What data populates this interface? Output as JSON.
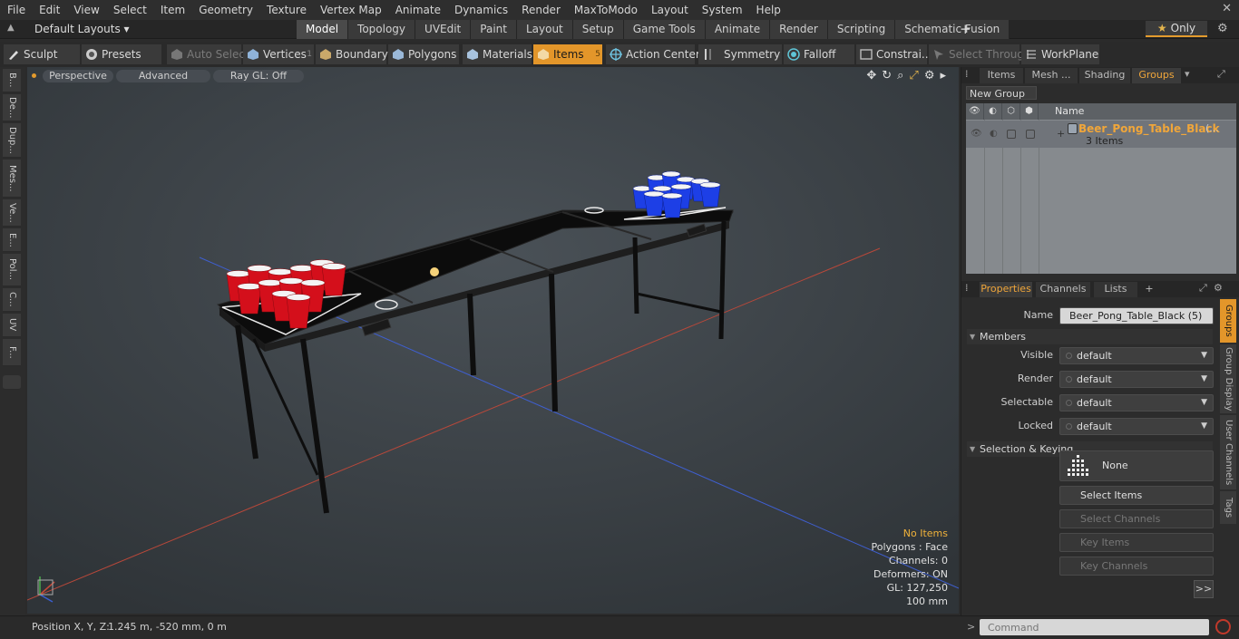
{
  "menu": [
    "File",
    "Edit",
    "View",
    "Select",
    "Item",
    "Geometry",
    "Texture",
    "Vertex Map",
    "Animate",
    "Dynamics",
    "Render",
    "MaxToModo",
    "Layout",
    "System",
    "Help"
  ],
  "layout": {
    "selector": "Default Layouts ▾",
    "tabs": [
      "Model",
      "Topology",
      "UVEdit",
      "Paint",
      "Layout",
      "Setup",
      "Game Tools",
      "Animate",
      "Render",
      "Scripting",
      "Schematic Fusion"
    ],
    "active_tab": "Model",
    "add": "+",
    "only_label": "Only"
  },
  "toolbar": {
    "sculpt": "Sculpt",
    "presets": "Presets",
    "auto_select": "Auto Select",
    "vertices": "Vertices",
    "vertices_count": "1",
    "boundary": "Boundary",
    "polygons": "Polygons",
    "materials": "Materials",
    "items": "Items",
    "items_count": "5",
    "action_center": "Action Center",
    "symmetry": "Symmetry",
    "falloff": "Falloff",
    "constraints": "Constrai...",
    "select_through": "Select Through",
    "workplane": "WorkPlane"
  },
  "left_strip": [
    "B...",
    "De...",
    "Dup...",
    "Mes...",
    "Ve...",
    "E...",
    "Pol...",
    "C...",
    "UV",
    "F..."
  ],
  "viewport": {
    "perspective": "Perspective",
    "advanced": "Advanced",
    "raygl": "Ray GL: Off",
    "info": {
      "no_items": "No Items",
      "polygons": "Polygons : Face",
      "channels": "Channels: 0",
      "deformers": "Deformers: ON",
      "gl": "GL: 127,250",
      "scale": "100 mm"
    }
  },
  "status": {
    "label": "Position X, Y, Z:",
    "value": "1.245 m, -520 mm, 0 m",
    "command_placeholder": "Command"
  },
  "groups_panel": {
    "tabs": [
      "Items",
      "Mesh ...",
      "Shading",
      "Groups"
    ],
    "active_tab": "Groups",
    "new_group": "New Group",
    "col_name": "Name",
    "group_name": "Beer_Pong_Table_Black",
    "group_name_more": "(...",
    "group_count": "3 Items"
  },
  "properties_panel": {
    "tabs": [
      "Properties",
      "Channels",
      "Lists",
      "+"
    ],
    "active_tab": "Properties",
    "name_label": "Name",
    "name_value": "Beer_Pong_Table_Black (5)",
    "members": "Members",
    "visible_label": "Visible",
    "visible_value": "default",
    "render_label": "Render",
    "render_value": "default",
    "selectable_label": "Selectable",
    "selectable_value": "default",
    "locked_label": "Locked",
    "locked_value": "default",
    "selection_keying": "Selection & Keying",
    "none": "None",
    "select_items": "Select Items",
    "select_channels": "Select Channels",
    "key_items": "Key Items",
    "key_channels": "Key Channels",
    "more": ">>"
  },
  "side_tabs": [
    "Groups",
    "Group Display",
    "User Channels",
    "Tags"
  ],
  "colors": {
    "accent": "#e3962a",
    "red_cup": "#e0101c",
    "blue_cup": "#1b3fe0",
    "table": "#111111"
  }
}
